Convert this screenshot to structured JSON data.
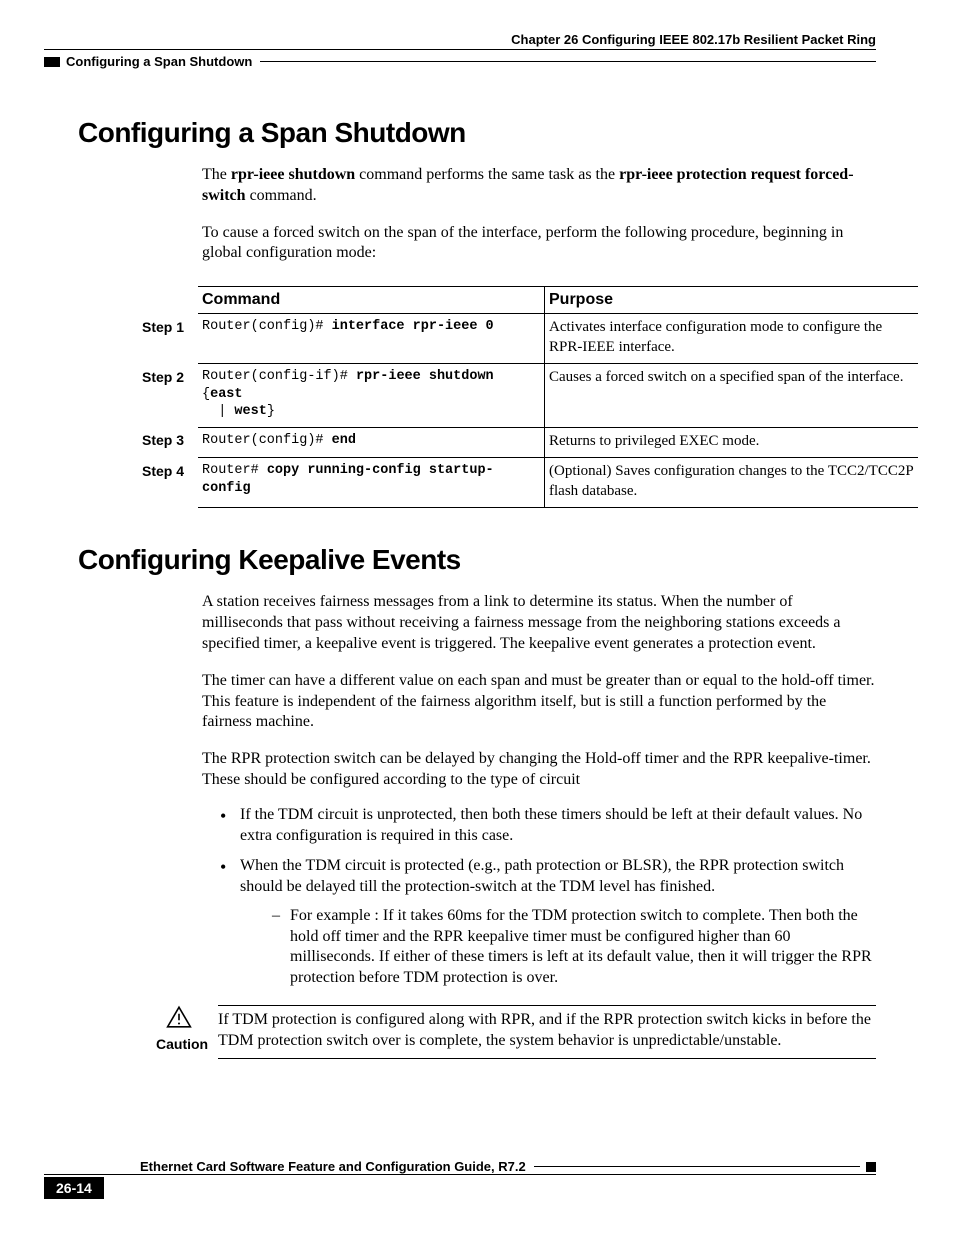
{
  "header": {
    "chapter": "Chapter 26    Configuring IEEE 802.17b Resilient Packet Ring",
    "breadcrumb": "Configuring a Span Shutdown"
  },
  "section1": {
    "title": "Configuring a Span Shutdown",
    "para1_pre": "The ",
    "para1_b1": "rpr-ieee shutdown",
    "para1_mid": " command performs the same task as the ",
    "para1_b2": "rpr-ieee protection request forced-switch",
    "para1_post": " command.",
    "para2": "To cause a forced switch on the span of the interface, perform the following procedure, beginning in global configuration mode:"
  },
  "table": {
    "head_cmd": "Command",
    "head_purpose": "Purpose",
    "rows": [
      {
        "step": "Step 1",
        "cmd_pre": "Router(config)# ",
        "cmd_b": "interface rpr-ieee 0",
        "purpose": "Activates interface configuration mode to configure the RPR-IEEE interface."
      },
      {
        "step": "Step 2",
        "cmd_pre": "Router(config-if)# ",
        "cmd_b1": "rpr-ieee shutdown",
        "cmd_mid": " {",
        "cmd_b2": "east",
        "cmd_mid2": " | ",
        "cmd_b3": "west",
        "cmd_post": "}",
        "purpose": "Causes a forced switch on a specified span of the interface."
      },
      {
        "step": "Step 3",
        "cmd_pre": "Router(config)# ",
        "cmd_b": "end",
        "purpose": "Returns to privileged EXEC mode."
      },
      {
        "step": "Step 4",
        "cmd_pre": "Router# ",
        "cmd_b": "copy running-config startup-config",
        "purpose": "(Optional) Saves configuration changes to the TCC2/TCC2P flash database."
      }
    ]
  },
  "section2": {
    "title": "Configuring Keepalive Events",
    "para1": "A station receives fairness messages from a link to determine its status. When the number of milliseconds that pass without receiving a fairness message from the neighboring stations exceeds a specified timer, a keepalive event is triggered. The keepalive event generates a protection event.",
    "para2": "The timer can have a different value on each span and must be greater than or equal to the hold-off timer. This feature is independent of the fairness algorithm itself, but is still a function performed by the fairness machine.",
    "para3": "The RPR protection switch can be delayed by changing the Hold-off timer and the RPR keepalive-timer. These should be configured according to the type of circuit",
    "bullet1": "If the TDM circuit is unprotected, then both these timers should be left at their default values. No extra configuration is required in this case.",
    "bullet2": "When the TDM circuit is protected (e.g., path protection or BLSR), the RPR protection switch should be delayed till the protection-switch at the TDM level has finished.",
    "sub1": "For example : If it takes 60ms for the TDM protection switch to complete. Then both the hold off timer and the RPR keepalive timer must be configured higher than 60 milliseconds. If either of these timers is left at its default value, then it will trigger the RPR protection before TDM protection is over."
  },
  "caution": {
    "label": "Caution",
    "text": "If TDM protection is configured along with RPR, and if the RPR protection switch kicks in before the TDM protection switch over is complete, the system behavior is unpredictable/unstable."
  },
  "footer": {
    "guide": "Ethernet Card Software Feature and Configuration Guide, R7.2",
    "page": "26-14"
  }
}
